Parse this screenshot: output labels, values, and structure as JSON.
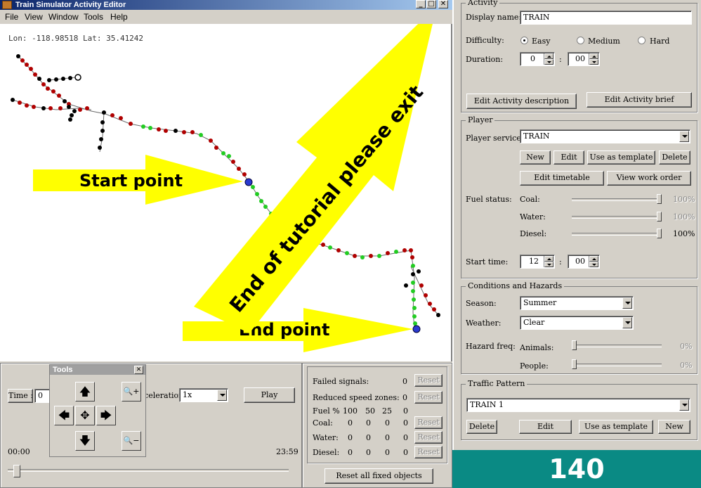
{
  "window": {
    "title": "Train Simulator Activity Editor",
    "minimize": "_",
    "maximize": "□",
    "close": "✕"
  },
  "menu": [
    "File",
    "View",
    "Window",
    "Tools",
    "Help"
  ],
  "map": {
    "coords": "Lon: -118.98518  Lat: 35.41242",
    "annotations": {
      "start": "Start point",
      "end": "End point",
      "exit": "End of tutorial please exit"
    },
    "colors": {
      "annotation": "#ffff00",
      "track_red": "#b00000",
      "track_green": "#22cc22",
      "track_black": "#000000"
    }
  },
  "timeline": {
    "time_label": "Time :",
    "time_value": "0",
    "acceleration_label": "Acceleration",
    "acceleration_value": "1x",
    "play_label": "Play",
    "start_time": "00:00",
    "end_time": "23:59",
    "slider_position": 0.0
  },
  "tools": {
    "title": "Tools",
    "close": "✕",
    "up": "🡅",
    "down": "🡇",
    "left": "🡄",
    "right": "🡆",
    "center": "✥",
    "zoom_in": "🔍+",
    "zoom_out": "🔍−"
  },
  "fixed_objects": {
    "failed_signals_label": "Failed signals:",
    "failed_signals_value": "0",
    "reduced_speed_label": "Reduced speed zones:",
    "reduced_speed_value": "0",
    "fuel_label": "Fuel %",
    "fuel_headers": [
      "100",
      "50",
      "25",
      "0"
    ],
    "rows": [
      {
        "label": "Coal:",
        "values": [
          "0",
          "0",
          "0",
          "0"
        ]
      },
      {
        "label": "Water:",
        "values": [
          "0",
          "0",
          "0",
          "0"
        ]
      },
      {
        "label": "Diesel:",
        "values": [
          "0",
          "0",
          "0",
          "0"
        ]
      }
    ],
    "reset_label": "Reset",
    "reset_all_label": "Reset all fixed objects"
  },
  "activity": {
    "group_title": "Activity",
    "display_name_label": "Display name:",
    "display_name": "TRAIN",
    "difficulty_label": "Difficulty:",
    "difficulty_options": [
      "Easy",
      "Medium",
      "Hard"
    ],
    "difficulty_selected": "Easy",
    "duration_label": "Duration:",
    "duration_hours": "0",
    "duration_minutes": "00",
    "colon": ":",
    "edit_description": "Edit Activity description",
    "edit_brief": "Edit Activity brief"
  },
  "player": {
    "group_title": "Player",
    "service_label": "Player service:",
    "service_value": "TRAIN",
    "new": "New",
    "edit": "Edit",
    "use_template": "Use as template",
    "delete": "Delete",
    "edit_timetable": "Edit timetable",
    "view_work_order": "View work order",
    "fuel_status_label": "Fuel status:",
    "fuel": [
      {
        "label": "Coal:",
        "value": "100%",
        "level": 1.0
      },
      {
        "label": "Water:",
        "value": "100%",
        "level": 1.0
      },
      {
        "label": "Diesel:",
        "value": "100%",
        "level": 1.0
      }
    ],
    "start_time_label": "Start time:",
    "start_hour": "12",
    "start_minute": "00",
    "colon": ":"
  },
  "conditions": {
    "group_title": "Conditions and Hazards",
    "season_label": "Season:",
    "season_value": "Summer",
    "weather_label": "Weather:",
    "weather_value": "Clear",
    "hazard_label": "Hazard freq:",
    "animals_label": "Animals:",
    "animals_value": "0%",
    "animals_level": 0.0,
    "people_label": "People:",
    "people_value": "0%",
    "people_level": 0.0
  },
  "traffic": {
    "group_title": "Traffic Pattern",
    "value": "TRAIN 1",
    "delete": "Delete",
    "edit": "Edit",
    "use_template": "Use as template",
    "new": "New"
  },
  "badge": {
    "number": "140",
    "color": "#0a8a84"
  }
}
